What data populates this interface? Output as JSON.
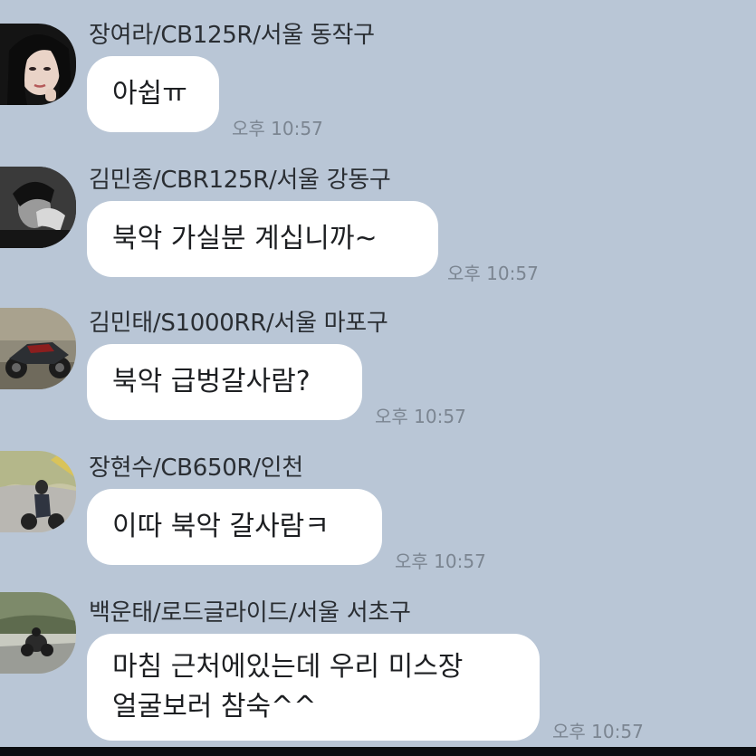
{
  "messages": [
    {
      "sender": "장여라/CB125R/서울 동작구",
      "text": "아쉽ㅠ",
      "time": "오후 10:57",
      "avatar": "portrait-avatar"
    },
    {
      "sender": "김민종/CBR125R/서울 강동구",
      "text": "북악 가실분 계십니까~",
      "time": "오후 10:57",
      "avatar": "bw-portrait-avatar"
    },
    {
      "sender": "김민태/S1000RR/서울 마포구",
      "text": "북악 급벙갈사람?",
      "time": "오후 10:57",
      "avatar": "motorcycle-avatar"
    },
    {
      "sender": "장현수/CB650R/인천",
      "text": "이따 북악 갈사람ㅋ",
      "time": "오후 10:57",
      "avatar": "rider-avatar"
    },
    {
      "sender": "백운태/로드글라이드/서울 서초구",
      "text_line1": "마침 근처에있는데 우리 미스장",
      "text_line2": "얼굴보러 참숙^^",
      "time": "오후 10:57",
      "avatar": "road-rider-avatar"
    }
  ]
}
